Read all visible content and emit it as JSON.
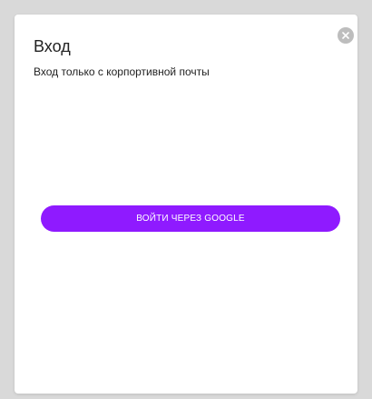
{
  "modal": {
    "title": "Вход",
    "subtitle": "Вход только с корпортивной почты",
    "close_icon": "close-icon",
    "google_button_label": "ВОЙТИ ЧЕРЕЗ GOOGLE"
  },
  "colors": {
    "accent": "#8f1aff",
    "backdrop": "#d9d9d9",
    "close_button": "#bdbdbd"
  }
}
